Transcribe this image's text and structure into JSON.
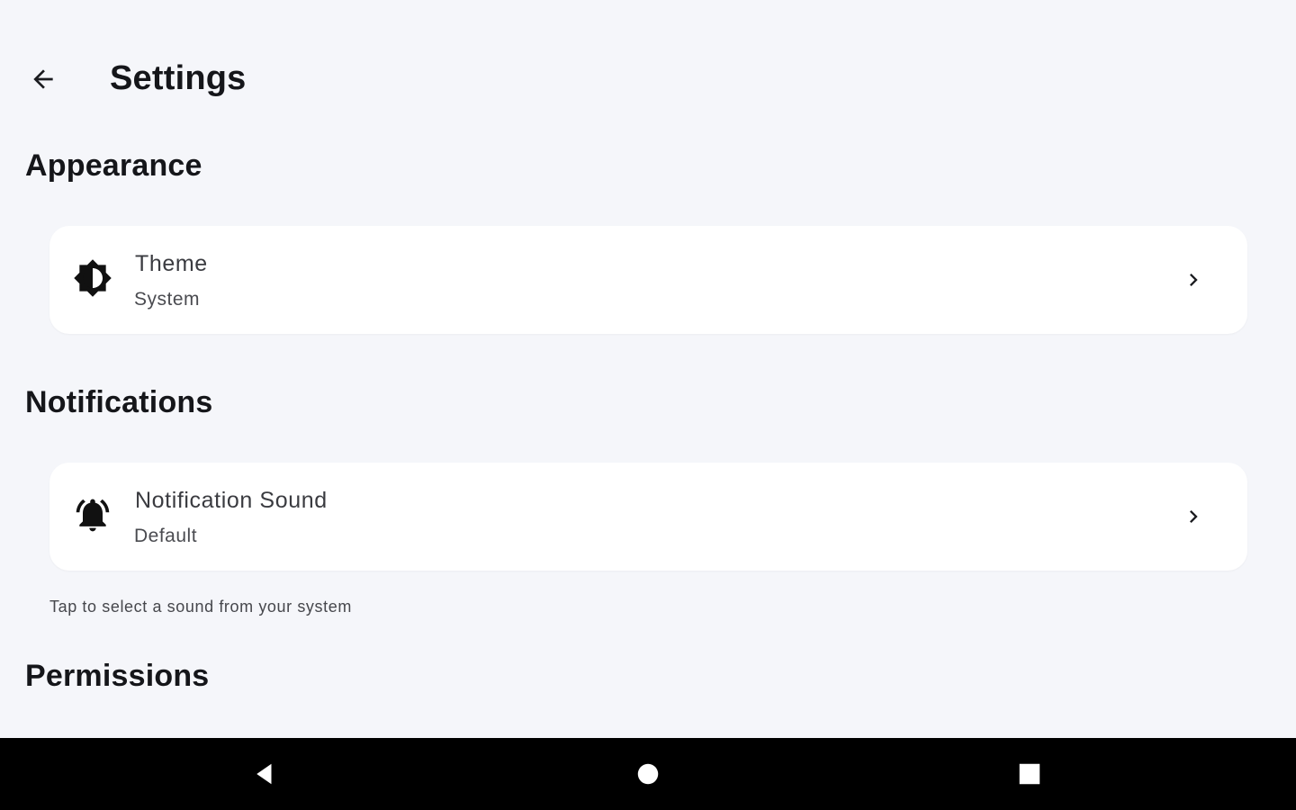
{
  "app_bar": {
    "title": "Settings"
  },
  "sections": {
    "appearance": {
      "header": "Appearance",
      "theme": {
        "icon": "brightness-contrast-icon",
        "title": "Theme",
        "value": "System"
      }
    },
    "notifications": {
      "header": "Notifications",
      "sound": {
        "icon": "bell-ringing-icon",
        "title": "Notification Sound",
        "value": "Default"
      },
      "helper": "Tap to select a sound from your system"
    },
    "permissions": {
      "header": "Permissions"
    }
  },
  "nav_bar": {
    "back_icon": "triangle-back-icon",
    "home_icon": "circle-home-icon",
    "recents_icon": "square-recents-icon"
  },
  "colors": {
    "background": "#f5f6fa",
    "card": "#ffffff",
    "text_primary": "#15161a",
    "nav_bar": "#000000"
  }
}
